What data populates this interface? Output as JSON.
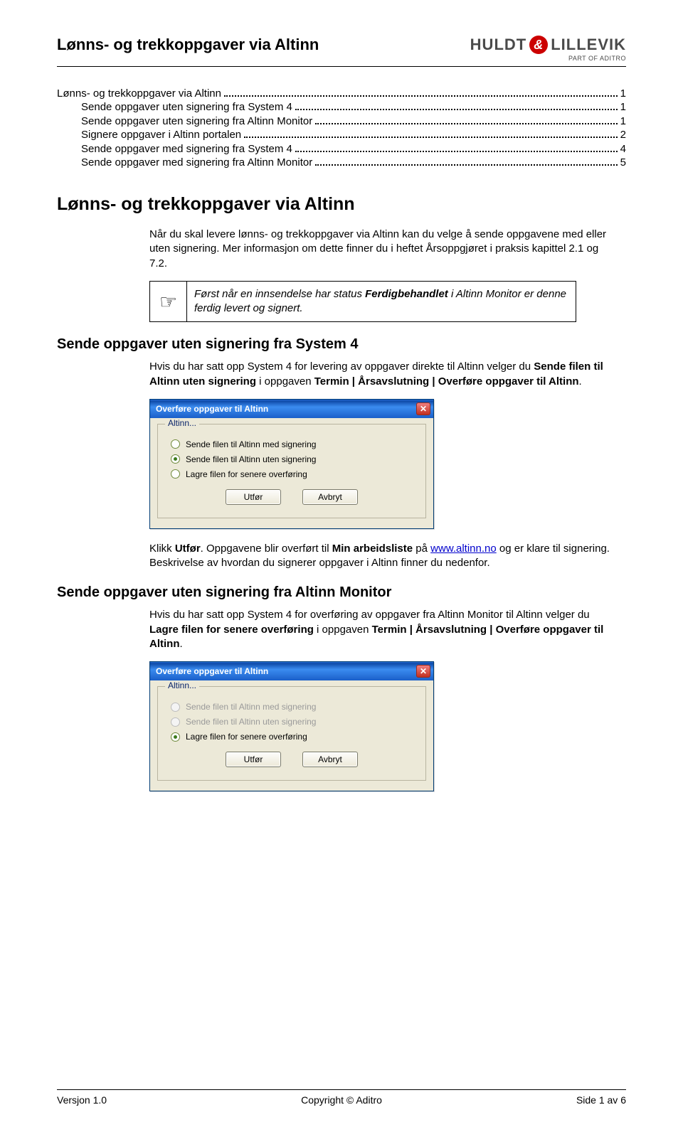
{
  "header": {
    "title": "Lønns- og trekkoppgaver via Altinn",
    "brand_left": "HULDT",
    "brand_right": "LILLEVIK",
    "brand_sub": "PART OF ADITRO"
  },
  "toc": [
    {
      "label": "Lønns- og trekkoppgaver via Altinn",
      "page": "1",
      "indent": false
    },
    {
      "label": "Sende oppgaver uten signering fra System 4",
      "page": "1",
      "indent": true
    },
    {
      "label": "Sende oppgaver uten signering fra Altinn Monitor",
      "page": "1",
      "indent": true
    },
    {
      "label": "Signere oppgaver i Altinn portalen",
      "page": "2",
      "indent": true
    },
    {
      "label": "Sende oppgaver med signering fra System 4",
      "page": "4",
      "indent": true
    },
    {
      "label": "Sende oppgaver med signering fra Altinn Monitor",
      "page": "5",
      "indent": true
    }
  ],
  "main_heading": "Lønns- og trekkoppgaver via Altinn",
  "intro": "Når du skal levere lønns- og trekkoppgaver via Altinn kan du velge å sende oppgavene med eller uten signering. Mer informasjon om dette finner du i heftet Årsoppgjøret i praksis kapittel 2.1 og 7.2.",
  "note": {
    "pre": "Først når en innsendelse har status ",
    "bold": "Ferdigbehandlet",
    "post": " i Altinn Monitor er denne ferdig levert og signert."
  },
  "section1": {
    "heading": "Sende oppgaver uten signering fra System 4",
    "p1_pre": "Hvis du har satt opp System 4 for levering av oppgaver direkte til Altinn velger du ",
    "p1_b1": "Sende filen til Altinn uten signering",
    "p1_mid": " i oppgaven ",
    "p1_b2": "Termin | Årsavslutning | Overføre oppgaver til Altinn",
    "p1_end": ".",
    "after_pre": "Klikk ",
    "after_b1": "Utfør",
    "after_mid1": ". Oppgavene blir overført til ",
    "after_b2": "Min arbeidsliste",
    "after_mid2": " på ",
    "after_link": "www.altinn.no",
    "after_post": " og er klare til signering. Beskrivelse av hvordan du signerer oppgaver i Altinn finner du nedenfor."
  },
  "section2": {
    "heading": "Sende oppgaver uten signering fra Altinn Monitor",
    "p1_pre": "Hvis du har satt opp System 4 for overføring av oppgaver fra Altinn Monitor til Altinn velger du ",
    "p1_b1": "Lagre filen for senere overføring",
    "p1_mid": " i oppgaven ",
    "p1_b2": "Termin | Årsavslutning | Overføre oppgaver til Altinn",
    "p1_end": "."
  },
  "dialog1": {
    "title": "Overføre oppgaver til Altinn",
    "legend": "Altinn...",
    "options": [
      {
        "label": "Sende filen til Altinn med signering",
        "selected": false,
        "disabled": false
      },
      {
        "label": "Sende filen til Altinn uten signering",
        "selected": true,
        "disabled": false
      },
      {
        "label": "Lagre filen for senere overføring",
        "selected": false,
        "disabled": false
      }
    ],
    "btn_ok": "Utfør",
    "btn_cancel": "Avbryt"
  },
  "dialog2": {
    "title": "Overføre oppgaver til Altinn",
    "legend": "Altinn...",
    "options": [
      {
        "label": "Sende filen til Altinn med signering",
        "selected": false,
        "disabled": true
      },
      {
        "label": "Sende filen til Altinn uten signering",
        "selected": false,
        "disabled": true
      },
      {
        "label": "Lagre filen for senere overføring",
        "selected": true,
        "disabled": false
      }
    ],
    "btn_ok": "Utfør",
    "btn_cancel": "Avbryt"
  },
  "footer": {
    "left": "Versjon 1.0",
    "center": "Copyright © Aditro",
    "right": "Side 1 av 6"
  }
}
